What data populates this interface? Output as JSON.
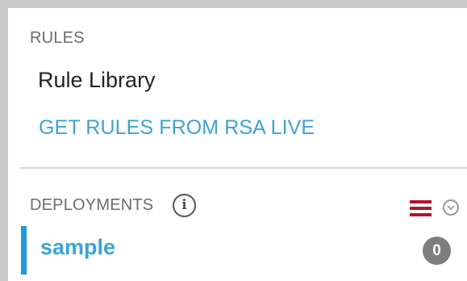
{
  "rules": {
    "header": "RULES",
    "rule_library_label": "Rule Library",
    "get_rules_label": "GET RULES FROM RSA LIVE"
  },
  "deployments": {
    "header": "DEPLOYMENTS",
    "info_icon_glyph": "i",
    "items": [
      {
        "label": "sample",
        "count": "0",
        "selected": true
      }
    ]
  },
  "icons": {
    "info": "info-icon",
    "menu": "hamburger-menu-icon",
    "expand": "chevron-down-circle-icon"
  },
  "colors": {
    "link": "#3aa3d8",
    "selected_bar": "#1f9ad6",
    "menu_icon": "#b3142a",
    "badge": "#7d7d7d"
  }
}
